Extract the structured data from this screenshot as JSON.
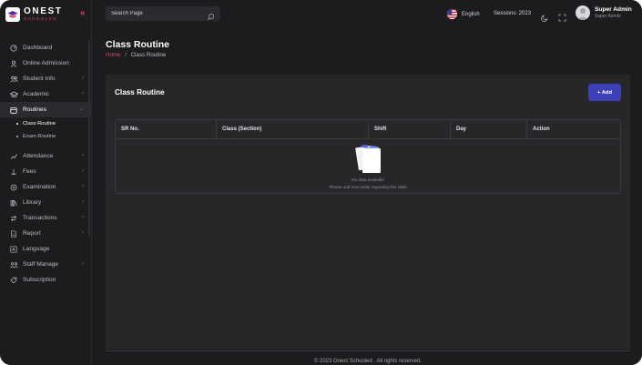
{
  "brand": {
    "name": "ONEST",
    "subtitle": "SCHOOLED"
  },
  "sidebar": {
    "items": [
      {
        "label": "Dashboard",
        "icon": "dashboard-icon",
        "has_chevron": false
      },
      {
        "label": "Online Admission",
        "icon": "user-icon",
        "has_chevron": false
      },
      {
        "label": "Student Info",
        "icon": "users-icon",
        "has_chevron": true
      },
      {
        "label": "Academic",
        "icon": "graduation-cap-icon",
        "has_chevron": true
      },
      {
        "label": "Routines",
        "icon": "calendar-icon",
        "has_chevron": true,
        "expanded": true
      },
      {
        "label": "Attendance",
        "icon": "attendance-icon",
        "has_chevron": true
      },
      {
        "label": "Fees",
        "icon": "fees-icon",
        "has_chevron": true
      },
      {
        "label": "Examination",
        "icon": "examination-icon",
        "has_chevron": true
      },
      {
        "label": "Library",
        "icon": "library-icon",
        "has_chevron": true
      },
      {
        "label": "Transactions",
        "icon": "transactions-icon",
        "has_chevron": true
      },
      {
        "label": "Report",
        "icon": "report-icon",
        "has_chevron": true
      },
      {
        "label": "Language",
        "icon": "language-icon",
        "has_chevron": false
      },
      {
        "label": "Staff Manage",
        "icon": "staff-icon",
        "has_chevron": true
      },
      {
        "label": "Subscription",
        "icon": "subscription-icon",
        "has_chevron": false
      }
    ],
    "subitems": [
      {
        "label": "Class Routine",
        "active": true
      },
      {
        "label": "Exam Routine",
        "active": false
      }
    ]
  },
  "header": {
    "search_placeholder": "Search Page",
    "language": "English",
    "session": "Sessions: 2023",
    "user_name": "Super Admin",
    "user_role": "Super Admin"
  },
  "page": {
    "title": "Class Routine",
    "breadcrumb_home": "Home",
    "breadcrumb_current": "Class Routine"
  },
  "card": {
    "title": "Class Routine",
    "add_button": "+ Add",
    "columns": [
      "SR No.",
      "Class (Section)",
      "Shift",
      "Day",
      "Action"
    ],
    "empty_title": "No data available",
    "empty_subtitle": "Please add new entity regarding this table"
  },
  "footer": {
    "text": "© 2023 Onest Schooled . All rights reserved."
  },
  "colors": {
    "accent": "#e0416b",
    "primary_button": "#3d3fb6",
    "background": "#1c1c1e",
    "card": "#27272a"
  }
}
